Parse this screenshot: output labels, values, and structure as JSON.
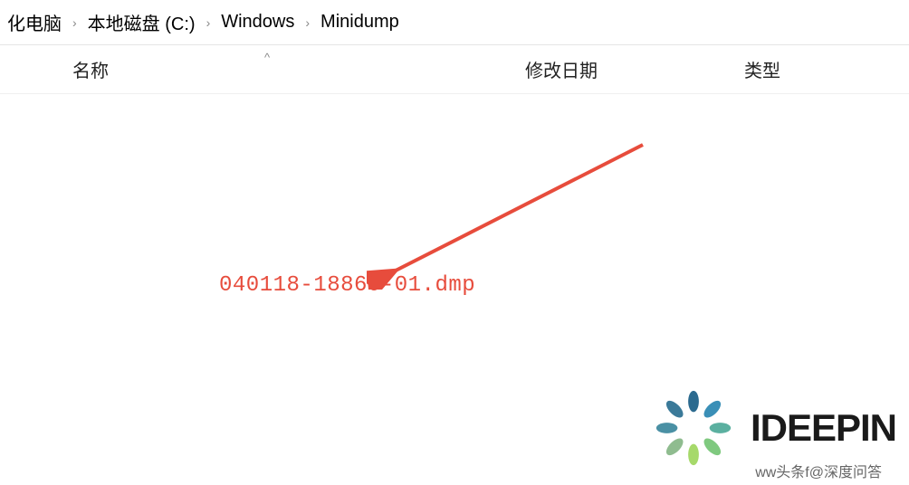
{
  "breadcrumb": {
    "items": [
      {
        "label": "化电脑"
      },
      {
        "label": "本地磁盘 (C:)"
      },
      {
        "label": "Windows"
      },
      {
        "label": "Minidump"
      }
    ]
  },
  "columns": {
    "name": "名称",
    "modified": "修改日期",
    "type": "类型",
    "sort_indicator": "^"
  },
  "annotation": {
    "filename": "040118-18860-01.dmp"
  },
  "watermark": {
    "brand": "IDEEPIN",
    "subtext": "ww头条f@深度问答"
  }
}
